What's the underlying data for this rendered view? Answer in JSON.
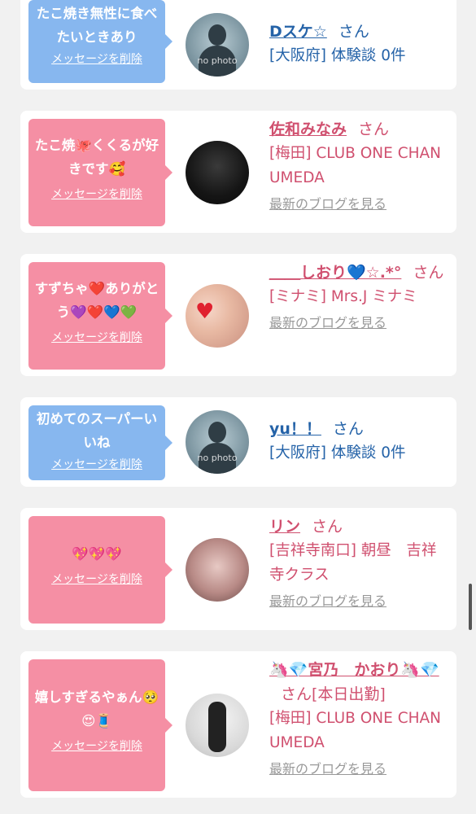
{
  "delete_label": "メッセージを削除",
  "blog_label": "最新のブログを見る",
  "honorific": "さん",
  "items": [
    {
      "bubble_text": "たこ焼き無性に食べたいときあり",
      "name": "Dスケ☆",
      "sub": "[大阪府] 体験談 0件",
      "theme": "blue",
      "avatar": "no-photo"
    },
    {
      "bubble_text": "たこ焼🐙くくるが好きです🥰",
      "name": "佐和みなみ",
      "sub": "[梅田] CLUB ONE CHAN UMEDA",
      "theme": "pink",
      "avatar": "photo"
    },
    {
      "bubble_text": "すずちゃ❤️ありがとう💜❤️💙💚",
      "name": "＿＿しおり💙☆.*°",
      "sub": "[ミナミ] Mrs.J ミナミ",
      "theme": "pink",
      "avatar": "photo"
    },
    {
      "bubble_text": "初めてのスーパーいいね",
      "name": "yu！！",
      "sub": "[大阪府] 体験談 0件",
      "theme": "blue",
      "avatar": "no-photo"
    },
    {
      "bubble_text": "💖💖💖",
      "name": "リン",
      "sub": "[吉祥寺南口] 朝昼　吉祥寺クラス",
      "theme": "pink",
      "avatar": "photo"
    },
    {
      "bubble_text": "嬉しすぎるやぁん🥺😍🧵",
      "name": "🦄💎宮乃　かおり🦄💎",
      "name_suffix": "[本日出勤]",
      "sub": "[梅田] CLUB ONE CHAN UMEDA",
      "theme": "pink",
      "avatar": "photo"
    }
  ],
  "colors": {
    "blue_bubble": "#87b7ef",
    "pink_bubble": "#f58fa4",
    "blue_text": "#2563a8",
    "pink_text": "#d0506f"
  }
}
